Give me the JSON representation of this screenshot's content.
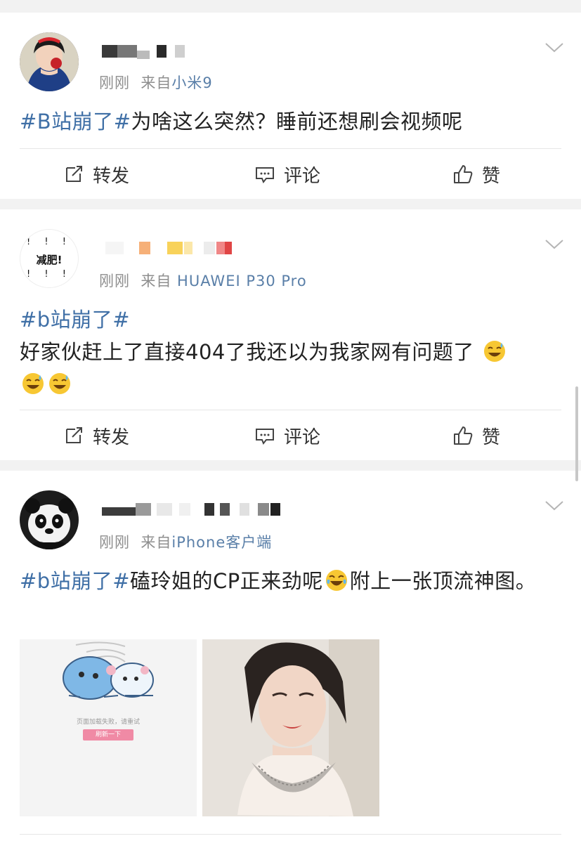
{
  "posts": [
    {
      "time": "刚刚",
      "from_label": "来自",
      "source": "小米9",
      "tag": "#B站崩了#",
      "text": "为啥这么突然？睡前还想刷会视频呢",
      "avatar_icon": "snow-white-avatar"
    },
    {
      "time": "刚刚",
      "from_label": "来自",
      "source": "HUAWEI P30 Pro",
      "tag": "#b站崩了#",
      "text": "好家伙赶上了直接404了我还以为我家网有问题了",
      "avatar_icon": "jianfei-text-avatar",
      "avatar_text": "减肥!",
      "avatar_marks": "! ! !",
      "emoji": "sweat-smile-emoji"
    },
    {
      "time": "刚刚",
      "from_label": "来自",
      "source": "iPhone客户端",
      "tag": "#b站崩了#",
      "text_before_emoji": "磕玲姐的CP正来劲呢",
      "text_after_emoji": "附上一张顶流神图。",
      "avatar_icon": "panda-avatar",
      "emoji": "tears-of-joy-emoji",
      "images": [
        {
          "icon": "bilibili-error-illustration",
          "error_text": "页面加载失败，请重试",
          "button_label": "刷新一下"
        },
        {
          "icon": "woman-portrait-photo"
        }
      ]
    }
  ],
  "actions": {
    "repost": "转发",
    "comment": "评论",
    "like": "赞"
  },
  "colors": {
    "link": "#3f6fa6",
    "meta": "#8e8e8e",
    "source": "#5a7fa8",
    "background": "#f2f2f2"
  }
}
